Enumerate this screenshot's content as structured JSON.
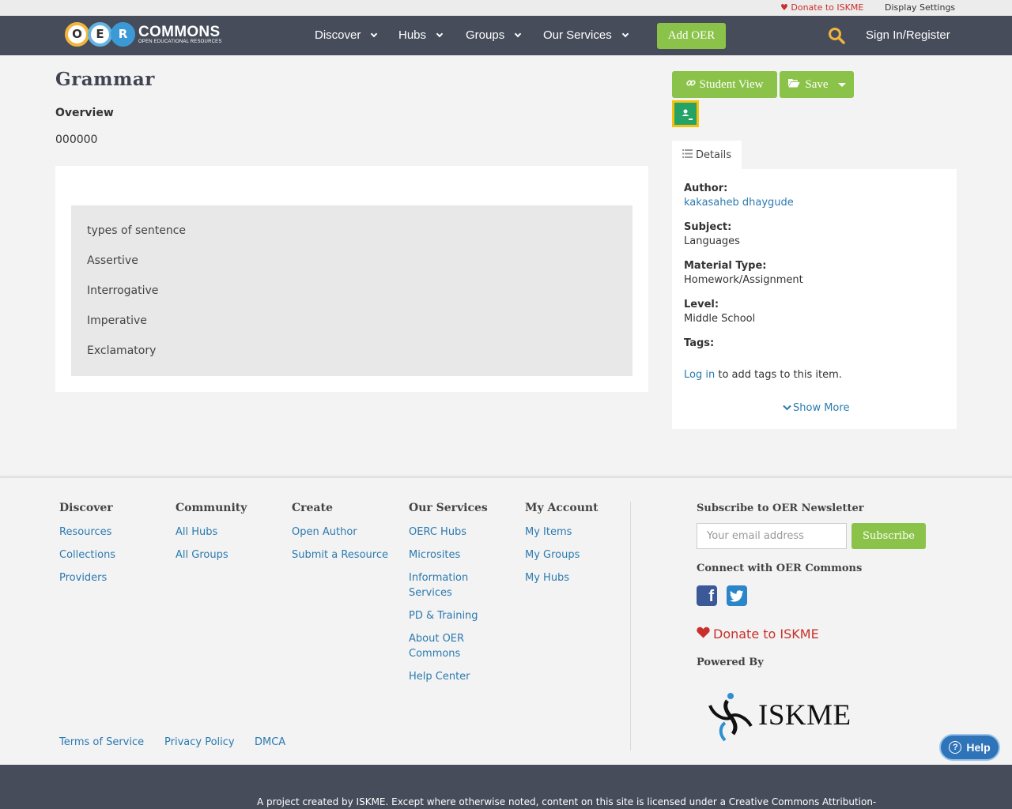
{
  "utility_bar": {
    "donate": "Donate to ISKME",
    "display_settings": "Display Settings"
  },
  "nav": {
    "logo_letters": [
      "O",
      "E",
      "R"
    ],
    "logo_big": "COMMONS",
    "logo_small": "OPEN EDUCATIONAL RESOURCES",
    "items": [
      {
        "label": "Discover"
      },
      {
        "label": "Hubs"
      },
      {
        "label": "Groups"
      },
      {
        "label": "Our Services"
      }
    ],
    "add_oer": "Add OER",
    "sign_in": "Sign In/Register"
  },
  "resource": {
    "title": "Grammar",
    "overview_label": "Overview",
    "overview_value": "000000",
    "content_lines": [
      "types of sentence",
      "Assertive",
      "Interrogative",
      "Imperative",
      "Exclamatory"
    ]
  },
  "sidebar": {
    "student_view": "Student View",
    "save": "Save",
    "details_tab": "Details",
    "author_label": "Author:",
    "author_value": "kakasaheb dhaygude",
    "subject_label": "Subject:",
    "subject_value": "Languages",
    "material_label": "Material Type:",
    "material_value": "Homework/Assignment",
    "level_label": "Level:",
    "level_value": "Middle School",
    "tags_label": "Tags:",
    "tags_login_link": "Log in",
    "tags_login_text": "to add tags to this item.",
    "show_more": "Show More"
  },
  "footer": {
    "columns": [
      {
        "heading": "Discover",
        "links": [
          "Resources",
          "Collections",
          "Providers"
        ]
      },
      {
        "heading": "Community",
        "links": [
          "All Hubs",
          "All Groups"
        ]
      },
      {
        "heading": "Create",
        "links": [
          "Open Author",
          "Submit a Resource"
        ]
      },
      {
        "heading": "Our Services",
        "links": [
          "OERC Hubs",
          "Microsites",
          "Information Services",
          "PD & Training",
          "About OER Commons",
          "Help Center"
        ]
      },
      {
        "heading": "My Account",
        "links": [
          "My Items",
          "My Groups",
          "My Hubs"
        ]
      }
    ],
    "legal": [
      "Terms of Service",
      "Privacy Policy",
      "DMCA"
    ],
    "newsletter_heading": "Subscribe to OER Newsletter",
    "email_placeholder": "Your email address",
    "subscribe": "Subscribe",
    "connect_heading": "Connect with OER Commons",
    "donate": "Donate to ISKME",
    "powered_by": "Powered By",
    "iskme_logo_text": "ISKME",
    "help": "Help",
    "bottom_text": "A project created by ISKME. Except where otherwise noted, content on this site is licensed under a Creative Commons Attribution-"
  },
  "colors": {
    "nav_bg": "#464c5a",
    "accent_green": "#8bc34a",
    "link_blue": "#2a7ab0",
    "donate_red": "#c9302c",
    "help_blue": "#2f73b8"
  }
}
